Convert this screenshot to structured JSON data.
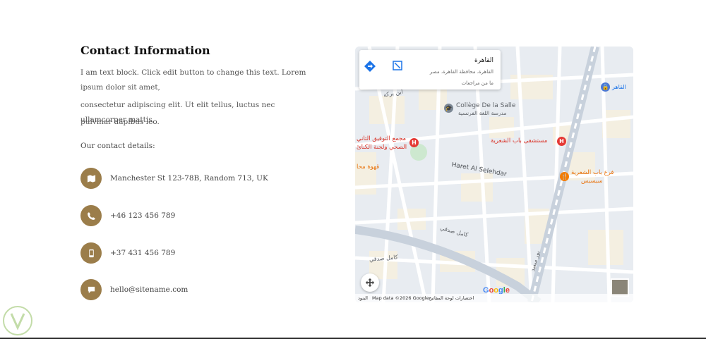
{
  "contact": {
    "title": "Contact Information",
    "para_line1": "I am text block. Click edit button to change this text. Lorem ipsum dolor sit amet,",
    "para_line2": "consectetur adipiscing elit. Ut elit tellus, luctus nec ullamcorper mattis,",
    "para_line3": "pulvinar dapibus leo.",
    "details_label": "Our contact details:",
    "items": [
      {
        "icon": "map-icon",
        "text": "Manchester St 123-78B, Random 713, UK"
      },
      {
        "icon": "phone-icon",
        "text": "+46 123 456 789"
      },
      {
        "icon": "mobile-icon",
        "text": "+37 431 456 789"
      },
      {
        "icon": "chat-icon",
        "text": "hello@sitename.com"
      }
    ],
    "accent_color": "#9b7d4a"
  },
  "map": {
    "card_title": "القاهرة",
    "card_subtitle": "القاهرة، محافظة القاهرة، مصر",
    "card_reviews": "ما من مراجعات",
    "labels": {
      "college": "Collège De la Salle",
      "college_ar": "مدرسة اللغة الفرنسية",
      "hospital_left": "مجمع التوفيق الثاني",
      "hospital_left2": "الصحي ولجنة الكنائ",
      "hospital_right": "مستشفى باب الشعرية",
      "cafe": "قهوة محا",
      "restaurant": "فرع باب الشعرية",
      "restaurant2": "سبسبس",
      "haret": "Haret Al Selehdar",
      "kamel": "كامل صدقي",
      "kamel2": "كامل صدقي",
      "bor_said": "بور سعيد",
      "ibn_barka": "ابن بركة",
      "top_right": "القاهر"
    },
    "footer": {
      "google": "Google",
      "keyboard": "اختصارات لوحة المفاتيح",
      "mapdata": "Map data ©2026 Google",
      "terms": "البنود"
    }
  }
}
